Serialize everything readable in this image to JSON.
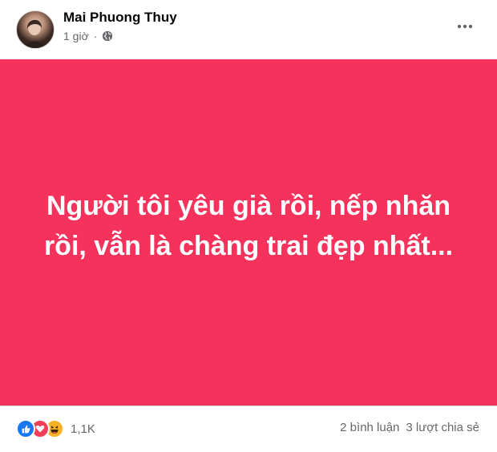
{
  "post": {
    "author": "Mai Phuong Thuy",
    "time": "1 giờ",
    "separator": "·",
    "privacy_icon": "globe-icon",
    "more_icon": "more-options-icon",
    "status_text": "Người tôi yêu già rồi, nếp nhăn rồi, vẫn là chàng trai đẹp nhất...",
    "background_color": "#f5325c"
  },
  "footer": {
    "reactions": [
      "like-icon",
      "love-icon",
      "haha-icon"
    ],
    "reaction_count": "1,1K",
    "comments": "2 bình luận",
    "shares": "3 lượt chia sẻ"
  }
}
